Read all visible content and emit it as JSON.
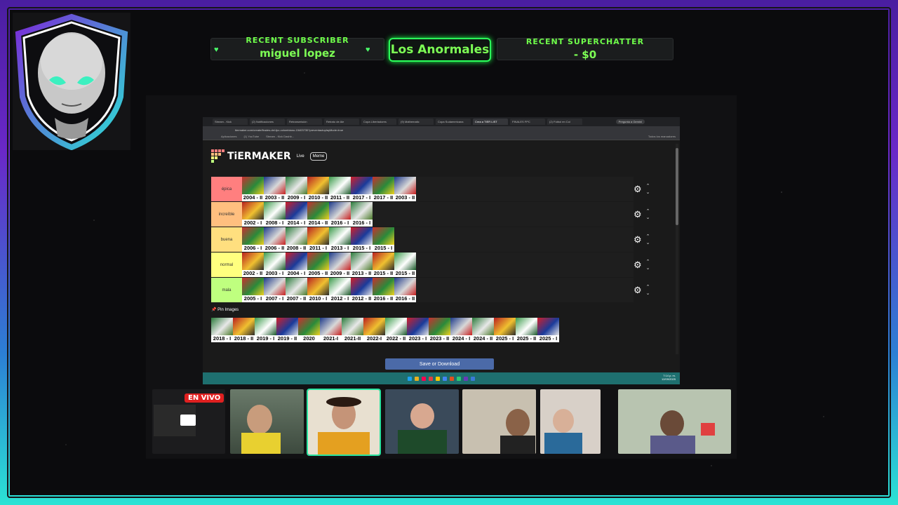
{
  "overlay": {
    "recent_subscriber_heading": "RECENT SUBSCRIBER",
    "recent_subscriber_name": "miguel lopez",
    "channel_name": "Los Anormales",
    "recent_superchatter_heading": "RECENT SUPERCHATTER",
    "recent_superchatter_value": "- $0",
    "live_badge": "EN VIVO",
    "accent_color": "#7dff55"
  },
  "browser": {
    "tabs": [
      "Stream - Kick",
      "(2) Notificaciones",
      "Retransmisión",
      "Retrato de Ale",
      "Copa Libertadores",
      "(9) Mathematic",
      "Copa Sudamericana",
      "Crea a TIER LIST",
      "FINALES FPC",
      "(2) Fútbol en Col"
    ],
    "active_tab_index": 7,
    "tab_right_label": "Pregunta a Gemini",
    "url": "tiermaker.com/create/finales-del-fpc-colombiano-15403730?preventautoplayMode=true",
    "bookmarks": [
      "Aplicaciones",
      "(1) YouTube",
      "Stream - Kick Dashb..."
    ],
    "bookmarks_right": "Todos los marcadores"
  },
  "tiermaker": {
    "brand": "TiERMAKER",
    "nav_live": "Live",
    "nav_meme": "Meme",
    "tiers": [
      {
        "label": "épica",
        "color": "#ff7f7f",
        "items": [
          "2004 - II",
          "2003 - II",
          "2009 - I",
          "2010 - II",
          "2011 - II",
          "2017 - I",
          "2017 - II",
          "2003 - II"
        ]
      },
      {
        "label": "increíble",
        "color": "#ffbf7f",
        "items": [
          "2002 - I",
          "2008 - I",
          "2014 - I",
          "2014 - II",
          "2016 - I",
          "2016 - I"
        ]
      },
      {
        "label": "buena",
        "color": "#ffdf7f",
        "items": [
          "2006 - I",
          "2006 - II",
          "2008 - II",
          "2011 - I",
          "2013 - I",
          "2015 - I",
          "2015 - I"
        ]
      },
      {
        "label": "normal",
        "color": "#ffff7f",
        "items": [
          "2002 - II",
          "2003 - I",
          "2004 - I",
          "2005 - II",
          "2009 - II",
          "2013 - II",
          "2015 - II",
          "2015 - II"
        ]
      },
      {
        "label": "mala",
        "color": "#bfff7f",
        "items": [
          "2005 - I",
          "2007 - I",
          "2007 - II",
          "2010 - I",
          "2012 - I",
          "2012 - II",
          "2016 - II",
          "2016 - II"
        ]
      }
    ],
    "pin_label": "Pin Images",
    "pool": [
      "2018 - I",
      "2018 - II",
      "2019 - I",
      "2019 - II",
      "2020",
      "2021-I",
      "2021-II",
      "2022-I",
      "2022 - II",
      "2023 - I",
      "2023 - II",
      "2024 - I",
      "2024 - II",
      "2025 - I",
      "2025 - II",
      "2025 - I"
    ],
    "save_button": "Save or Download"
  },
  "taskbar": {
    "time": "7:14 p. m.",
    "date": "12/09/2025"
  }
}
